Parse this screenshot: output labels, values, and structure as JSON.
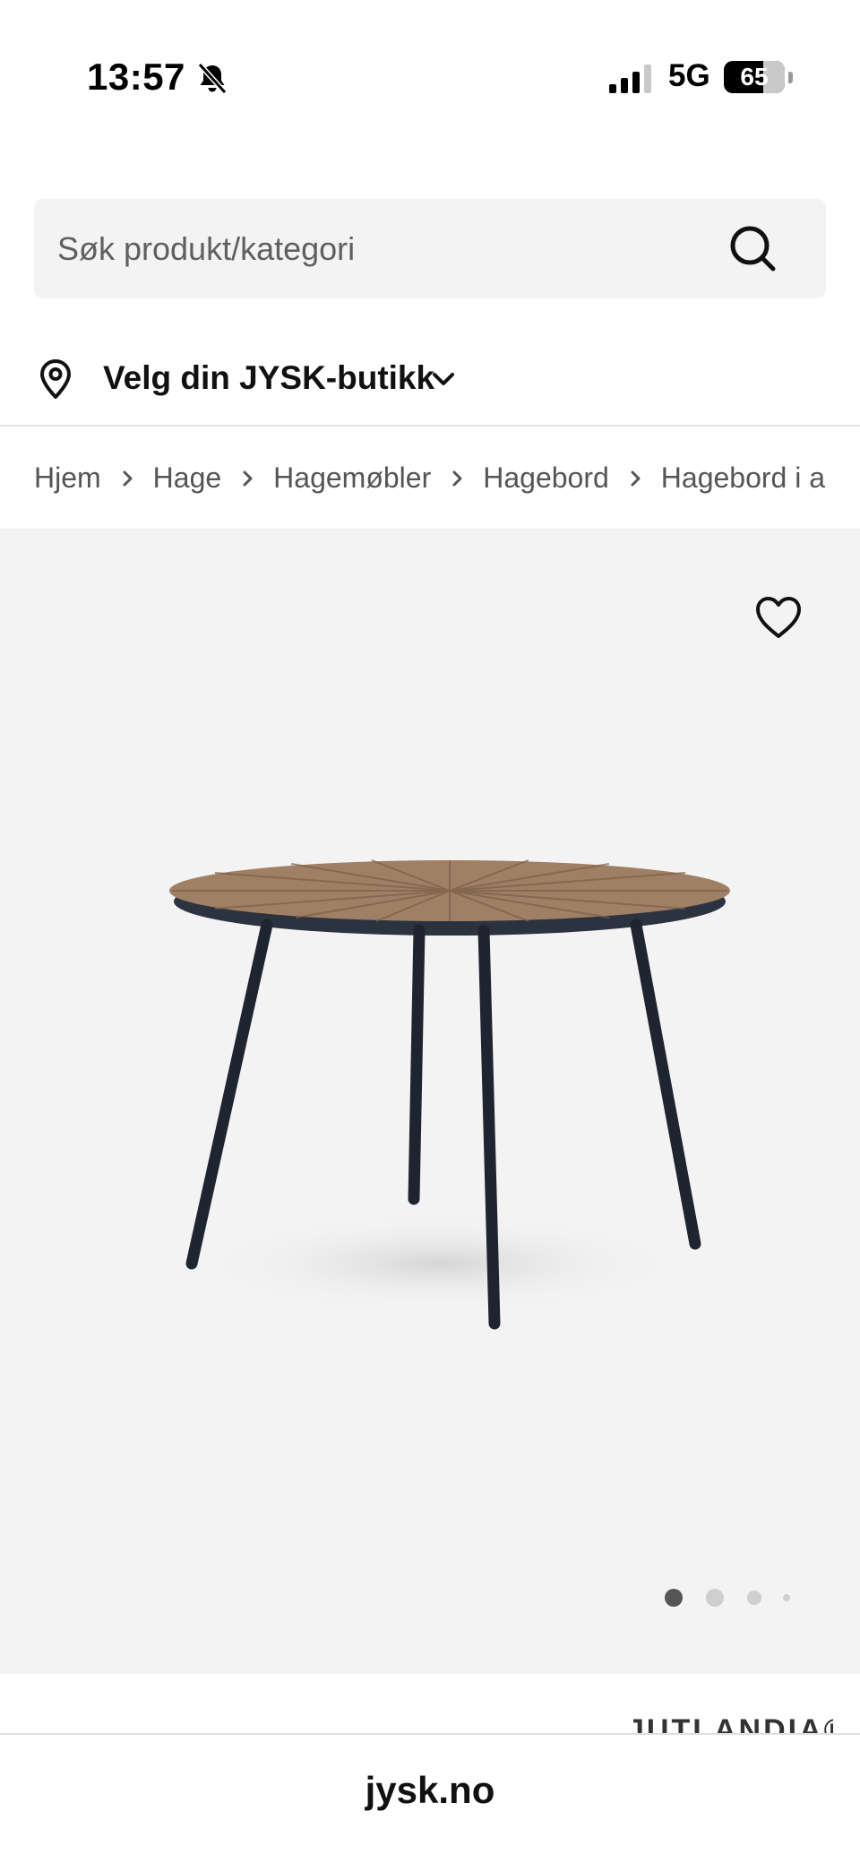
{
  "status_bar": {
    "time": "13:57",
    "network": "5G",
    "battery": "65",
    "icons": [
      "bell-slash-icon",
      "signal-icon",
      "battery-icon"
    ]
  },
  "search": {
    "placeholder": "Søk produkt/kategori",
    "value": "",
    "icon": "search-icon"
  },
  "store_selector": {
    "label": "Velg din JYSK-butikk",
    "icons": [
      "location-pin-icon",
      "chevron-down-icon"
    ]
  },
  "breadcrumb": {
    "items": [
      "Hjem",
      "Hage",
      "Hagemøbler",
      "Hagebord",
      "Hagebord i aluminium"
    ]
  },
  "gallery": {
    "favorite_icon": "heart-outline-icon",
    "image_description_icon": "product-image",
    "dots_count": 4,
    "active_dot": 0,
    "colors": {
      "background": "#f3f3f3",
      "dot_active": "#555555",
      "dot_inactive": "#cfcfcf"
    }
  },
  "brand": {
    "name": "JUTLANDIA®"
  },
  "browser": {
    "url": "jysk.no"
  }
}
